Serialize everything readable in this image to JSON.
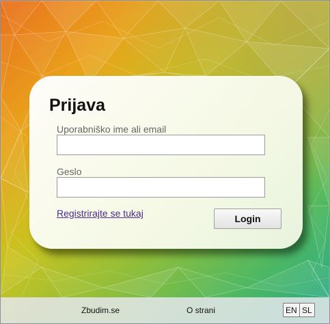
{
  "login": {
    "title": "Prijava",
    "username_label": "Uporabniško ime ali email",
    "username_value": "",
    "password_label": "Geslo",
    "password_value": "",
    "register_link": "Registrirajte se tukaj",
    "login_button": "Login"
  },
  "footer": {
    "site_link": "Zbudim.se",
    "about_link": "O strani",
    "languages": [
      "EN",
      "SL"
    ]
  }
}
